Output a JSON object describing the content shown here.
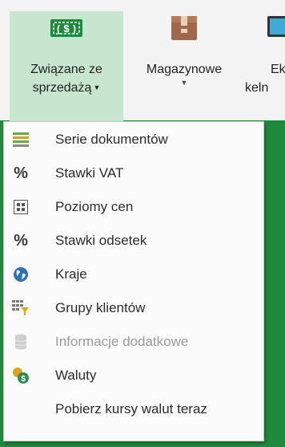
{
  "ribbon": {
    "buttons": [
      {
        "label_line1": "Związane ze",
        "label_line2": "sprzedażą",
        "icon": "money-icon",
        "has_dropdown": true,
        "active": true
      },
      {
        "label_line1": "Magazynowe",
        "label_line2": "",
        "icon": "box-icon",
        "has_dropdown": true,
        "active": false
      },
      {
        "label_line1": "Ek",
        "label_line2": "keln",
        "icon": "monitor-icon",
        "has_dropdown": false,
        "active": false
      }
    ]
  },
  "menu": {
    "items": [
      {
        "label": "Serie dokumentów",
        "icon": "document-series-icon",
        "enabled": true
      },
      {
        "label": "Stawki VAT",
        "icon": "percent-icon",
        "enabled": true
      },
      {
        "label": "Poziomy cen",
        "icon": "price-levels-icon",
        "enabled": true
      },
      {
        "label": "Stawki odsetek",
        "icon": "percent-icon",
        "enabled": true
      },
      {
        "label": "Kraje",
        "icon": "globe-icon",
        "enabled": true
      },
      {
        "label": "Grupy klientów",
        "icon": "customer-groups-icon",
        "enabled": true
      },
      {
        "label": "Informacje dodatkowe",
        "icon": "database-icon",
        "enabled": false
      },
      {
        "label": "Waluty",
        "icon": "currency-icon",
        "enabled": true
      },
      {
        "label": "Pobierz kursy walut teraz",
        "icon": "",
        "enabled": true
      }
    ]
  },
  "colors": {
    "accent_green": "#1f8a3d",
    "active_button_bg": "#c8e6cf",
    "menu_bg": "#fbfbfb",
    "disabled_text": "#9a9a9a"
  }
}
